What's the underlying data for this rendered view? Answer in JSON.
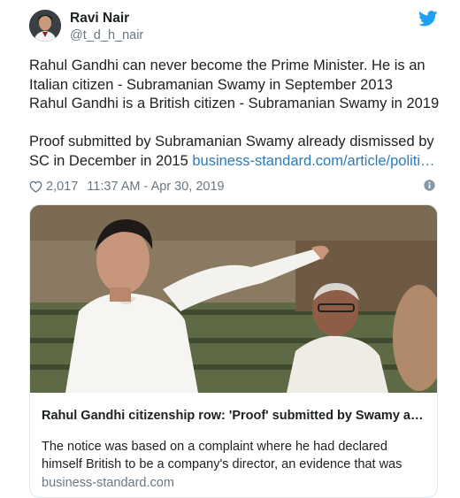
{
  "tweet": {
    "author_name": "Ravi Nair",
    "author_handle": "@t_d_h_nair",
    "text_lines": [
      "Rahul Gandhi can never become the Prime Minister. He is an",
      "Italian citizen - Subramanian Swamy in September 2013",
      "Rahul Gandhi is a British citizen - Subramanian Swamy in 2019"
    ],
    "text_lines_2": [
      "Proof submitted by Subramanian Swamy already dismissed by"
    ],
    "text_last_prefix": "SC in December in 2015 ",
    "link_text": "business-standard.com/article/politi…",
    "likes": "2,017",
    "timestamp": "11:37 AM - Apr 30, 2019"
  },
  "card": {
    "title": "Rahul Gandhi citizenship row: 'Proof' submitted by Swamy a…",
    "description_lines": [
      "The notice was based on a complaint where he had declared",
      "himself British to be a company's director, an evidence that was"
    ],
    "domain": "business-standard.com"
  },
  "colors": {
    "twitter_blue": "#1da1f2",
    "link": "#2b7bb9",
    "secondary_text": "#697882",
    "border": "#e1e8ed"
  },
  "icons": {
    "brand": "twitter-bird-icon",
    "like": "heart-icon",
    "info": "info-icon"
  }
}
